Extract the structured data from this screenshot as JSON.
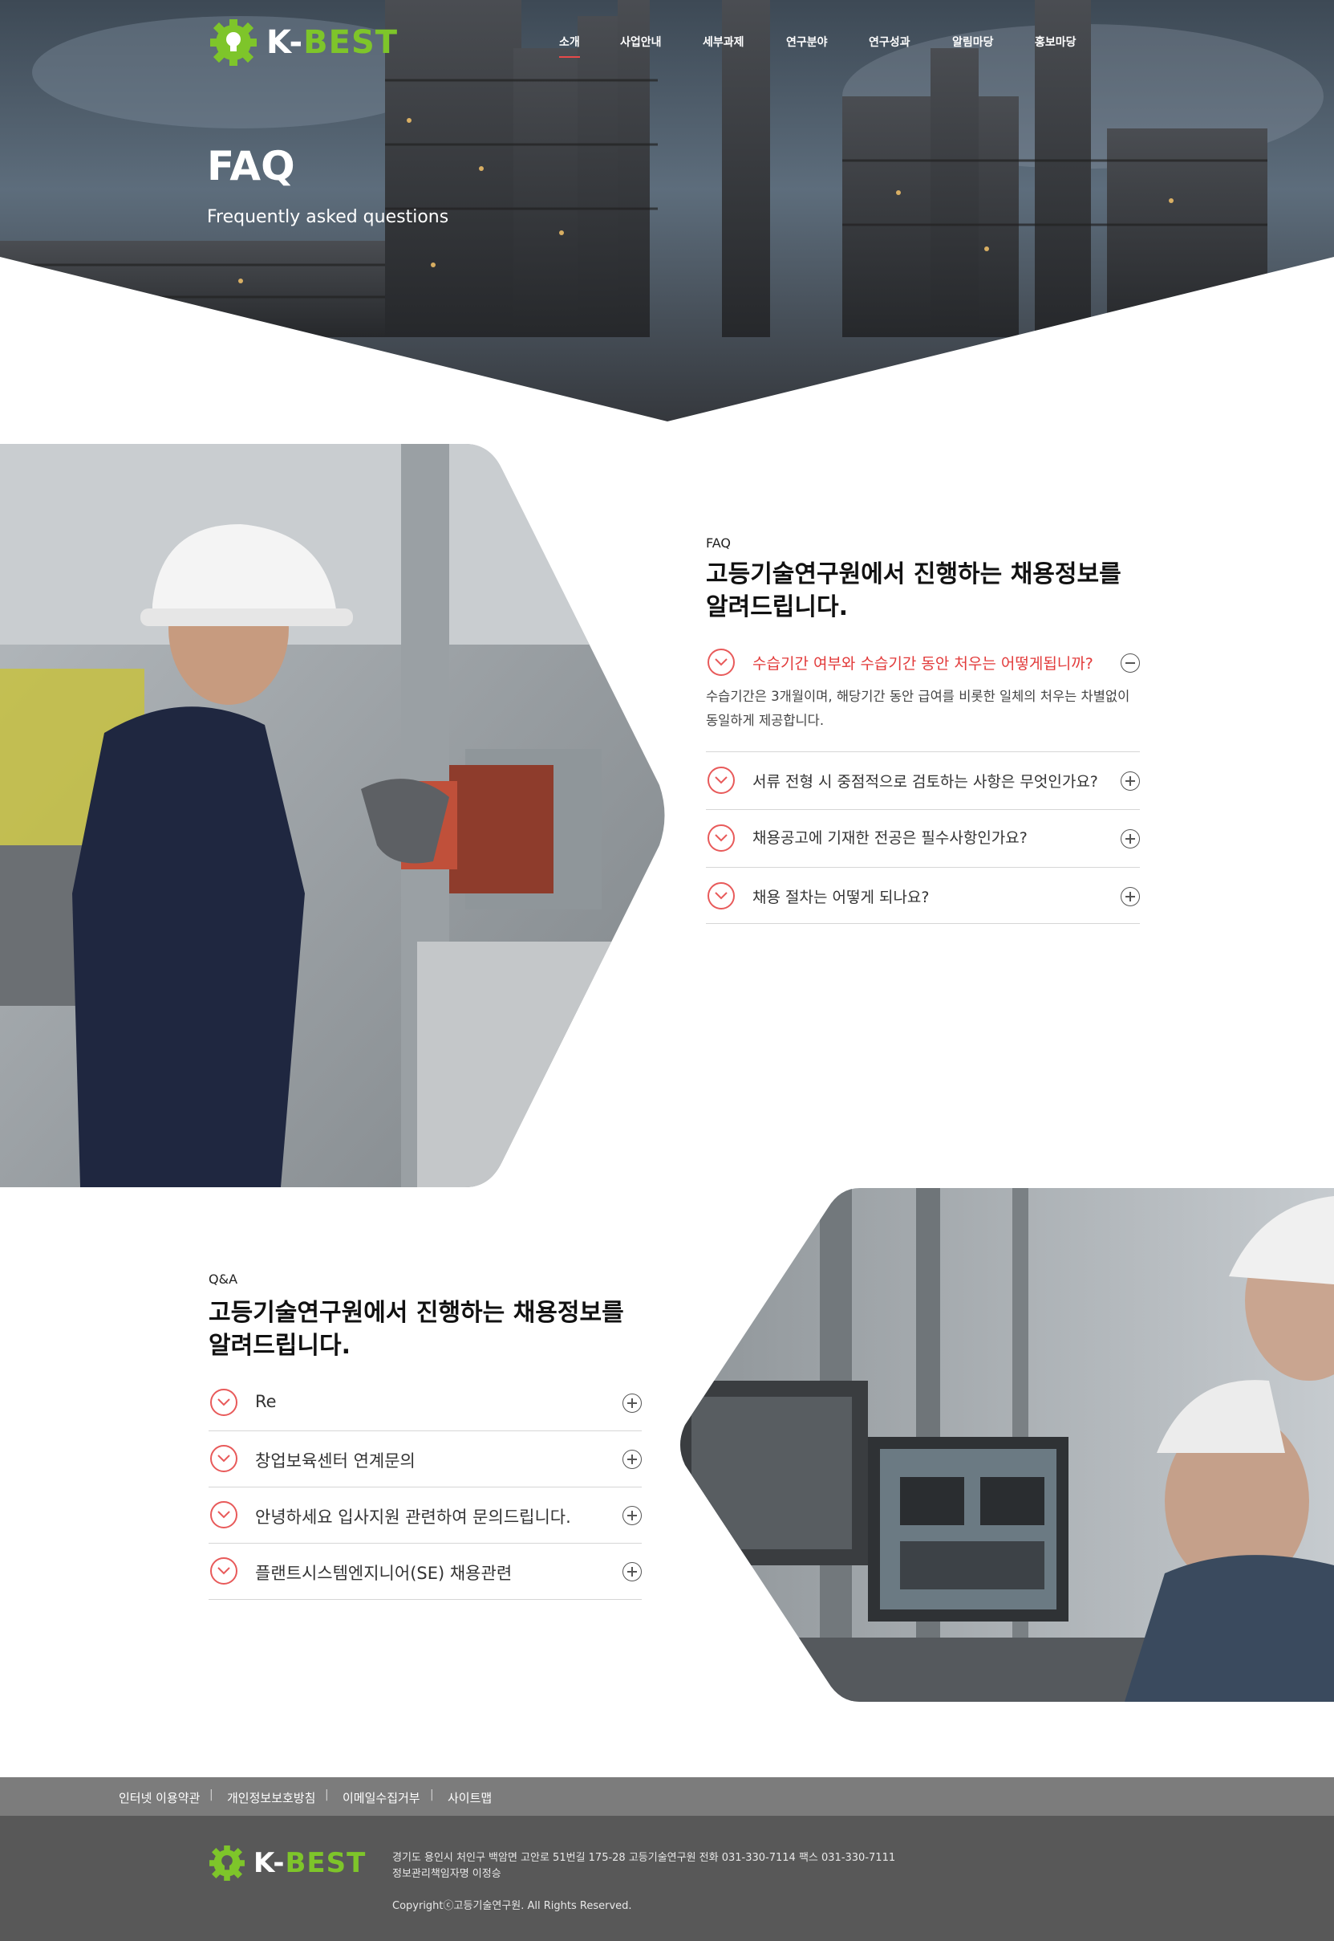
{
  "header": {
    "logo": {
      "prefix": "K-",
      "name": "BEST",
      "icon": "gear-bulb-icon"
    },
    "nav": [
      {
        "label": "소개",
        "active": true
      },
      {
        "label": "사업안내",
        "active": false
      },
      {
        "label": "세부과제",
        "active": false
      },
      {
        "label": "연구분야",
        "active": false
      },
      {
        "label": "연구성과",
        "active": false
      },
      {
        "label": "알림마당",
        "active": false
      },
      {
        "label": "홍보마당",
        "active": false
      }
    ]
  },
  "hero": {
    "title": "FAQ",
    "subtitle": "Frequently asked questions"
  },
  "faq": {
    "eyebrow": "FAQ",
    "heading_line1": "고등기술연구원에서 진행하는 채용정보를",
    "heading_line2": "알려드립니다.",
    "items": [
      {
        "question": "수습기간 여부와 수습기간 동안 처우는 어떻게됩니까?",
        "open": true,
        "answer_line1": "수습기간은 3개월이며, 해당기간 동안 급여를 비롯한 일체의 처우는 차별없이",
        "answer_line2": "동일하게 제공합니다."
      },
      {
        "question": "서류 전형 시 중점적으로 검토하는 사항은 무엇인가요?",
        "open": false
      },
      {
        "question": "채용공고에 기재한 전공은 필수사항인가요?",
        "open": false
      },
      {
        "question": "채용 절차는 어떻게 되나요?",
        "open": false
      }
    ]
  },
  "qna": {
    "eyebrow": "Q&A",
    "heading_line1": "고등기술연구원에서 진행하는 채용정보를",
    "heading_line2": "알려드립니다.",
    "items": [
      {
        "question": "Re"
      },
      {
        "question": "창업보육센터 연계문의"
      },
      {
        "question": "안녕하세요 입사지원 관련하여 문의드립니다."
      },
      {
        "question": "플랜트시스템엔지니어(SE) 채용관련"
      }
    ]
  },
  "footer": {
    "links": [
      "인터넷 이용약관",
      "개인정보보호방침",
      "이메일수집거부",
      "사이트맵"
    ],
    "separator": "|",
    "address": "경기도 용인시 처인구 백암면 고안로 51번길 175-28 고등기술연구원  전화 031-330-7114  팩스 031-330-7111",
    "privacy_officer": "정보관리책임자명 이정승",
    "copyright": "Copyrightⓒ고등기술연구원.  All Rights Reserved."
  },
  "colors": {
    "accent_red": "#e23a3a",
    "brand_green": "#7ec52a",
    "footer_dark": "#585858",
    "footer_bar": "#7c7c7c"
  }
}
